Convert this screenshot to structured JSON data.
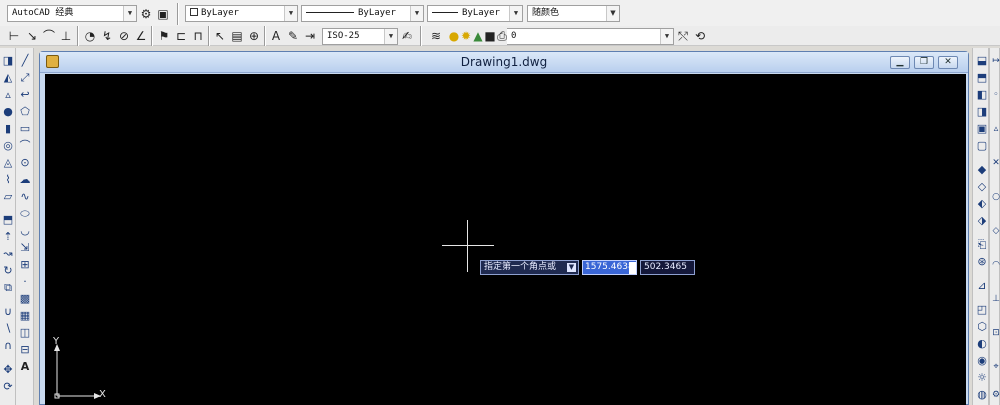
{
  "toolbar_row1": {
    "workspace": "AutoCAD 经典",
    "layer_color": "ByLayer",
    "linetype": "ByLayer",
    "lineweight": "ByLayer",
    "plot_color": "随颜色"
  },
  "toolbar_row2": {
    "dim_style": "ISO-25",
    "layer_current": "0"
  },
  "drawing_window": {
    "title": "Drawing1.dwg",
    "min_label": "▁",
    "restore_label": "❐",
    "close_label": "✕"
  },
  "dynamic_input": {
    "prompt": "指定第一个角点或",
    "x_value": "1575.4638",
    "y_value": "502.3465"
  },
  "ucs": {
    "x_label": "X",
    "y_label": "Y"
  },
  "colors": {
    "canvas_bg": "#000000",
    "crosshair": "#e6e6e6",
    "dyn_highlight": "#3a66d6",
    "title_bar": "#c9daf0"
  }
}
